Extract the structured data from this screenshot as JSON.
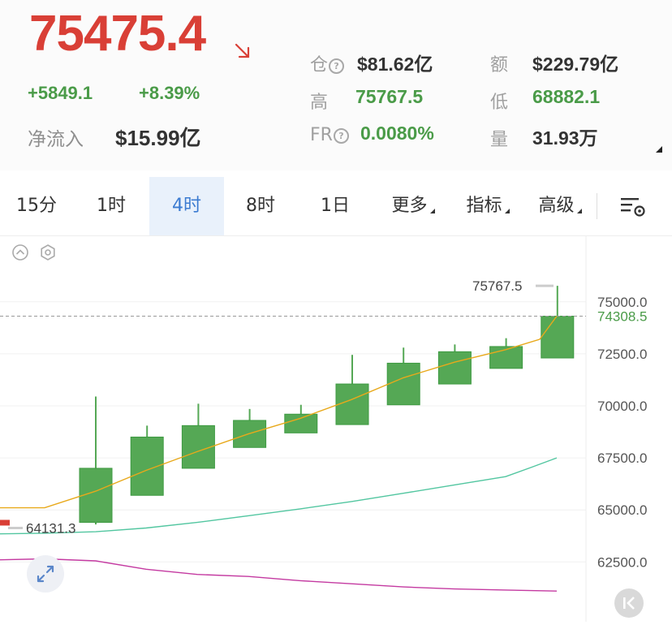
{
  "ticker": {
    "price": "75475.4",
    "change_abs": "+5849.1",
    "change_pct": "+8.39%",
    "net_inflow_label": "净流入",
    "net_inflow_value": "$15.99亿",
    "colors": {
      "down": "#d93f36",
      "up": "#4a9b48"
    }
  },
  "stats": {
    "position_label": "仓",
    "position_value": "$81.62亿",
    "amount_label": "额",
    "amount_value": "$229.79亿",
    "high_label": "高",
    "high_value": "75767.5",
    "low_label": "低",
    "low_value": "68882.1",
    "fr_label": "FR",
    "fr_value": "0.0080%",
    "volume_label": "量",
    "volume_value": "31.93万",
    "help_icon_glyph": "?"
  },
  "tabs": [
    {
      "label": "15分",
      "active": false
    },
    {
      "label": "1时",
      "active": false
    },
    {
      "label": "4时",
      "active": true
    },
    {
      "label": "8时",
      "active": false
    },
    {
      "label": "1日",
      "active": false
    },
    {
      "label": "更多",
      "active": false
    },
    {
      "label": "指标",
      "active": false
    },
    {
      "label": "高级",
      "active": false
    }
  ],
  "chart_data": {
    "type": "candlestick",
    "y_ticks": [
      "75000.0",
      "72500.0",
      "70000.0",
      "67500.0",
      "65000.0",
      "62500.0"
    ],
    "y_tick_values": [
      75000,
      72500,
      70000,
      67500,
      65000,
      62500
    ],
    "last_price_label": "74308.5",
    "last_price": 74308.5,
    "high_marker_label": "75767.5",
    "high_marker": 75767.5,
    "low_marker_label": "64131.3",
    "low_marker": 64131.3,
    "up_color": "#55a855",
    "ma_colors": [
      "#e8a91b",
      "#52c6a0",
      "#c43aa1"
    ],
    "candles": [
      {
        "o": 64400,
        "h": 70450,
        "l": 64300,
        "c": 67000
      },
      {
        "o": 65700,
        "h": 69050,
        "l": 65700,
        "c": 68500
      },
      {
        "o": 67000,
        "h": 70100,
        "l": 67000,
        "c": 69050
      },
      {
        "o": 68000,
        "h": 69850,
        "l": 68000,
        "c": 69300
      },
      {
        "o": 68700,
        "h": 70050,
        "l": 68700,
        "c": 69600
      },
      {
        "o": 69100,
        "h": 72450,
        "l": 69100,
        "c": 71050
      },
      {
        "o": 70050,
        "h": 72800,
        "l": 70050,
        "c": 72050
      },
      {
        "o": 71050,
        "h": 72950,
        "l": 71050,
        "c": 72600
      },
      {
        "o": 71800,
        "h": 73250,
        "l": 71800,
        "c": 72850
      },
      {
        "o": 72300,
        "h": 75767.5,
        "l": 72300,
        "c": 74308.5
      }
    ],
    "ma_fast": [
      65100,
      65100,
      65900,
      66900,
      67800,
      68650,
      69400,
      70300,
      71350,
      72100,
      72700,
      73200,
      74308.5
    ],
    "ma_mid": [
      63850,
      63880,
      63950,
      64130,
      64400,
      64720,
      65050,
      65400,
      65800,
      66200,
      66600,
      67050,
      67500
    ],
    "ma_slow": [
      62600,
      62650,
      62550,
      62150,
      61900,
      61800,
      61600,
      61450,
      61300,
      61200,
      61150,
      61100
    ]
  }
}
